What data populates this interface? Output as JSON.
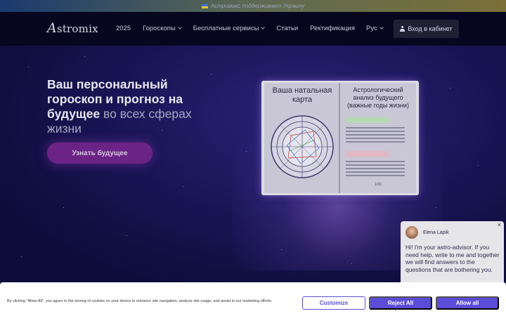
{
  "ribbon": {
    "text": "Астромикс поддерживает Украину"
  },
  "header": {
    "logo": {
      "initial": "A",
      "rest": "stromix"
    },
    "nav": [
      {
        "label": "2025",
        "has_dropdown": false
      },
      {
        "label": "Гороскопы",
        "has_dropdown": true
      },
      {
        "label": "Бесплатные сервисы",
        "has_dropdown": true
      },
      {
        "label": "Статьи",
        "has_dropdown": false
      },
      {
        "label": "Ректификация",
        "has_dropdown": false
      }
    ],
    "language": "Рус",
    "login_label": "Вход в кабинет"
  },
  "hero": {
    "title_bold": "Ваш персональный гороскоп и прогноз на будущее",
    "title_light": " во всех сферах жизни",
    "cta_label": "Узнать будущее"
  },
  "book": {
    "left_title": "Ваша натальная карта",
    "right_title": "Астрологический анализ будущего (важные годы жизни)",
    "page_number": "1/30"
  },
  "chat": {
    "name": "Elena Lapik",
    "message": "Hi! I'm your astro-advisor. If you need help, write to me and together we will find answers to the questions that are bothering you.",
    "close_glyph": "×"
  },
  "cookie": {
    "text": "By clicking \"Allow All\", you agree to the storing of cookies on your device to enhance site navigation, analyze site usage, and assist in our marketing efforts.",
    "customize_label": "Customize",
    "reject_label": "Reject All",
    "accept_label": "Allow all"
  },
  "colors": {
    "background": "#0d0b33",
    "cta": "#6b2486",
    "accent_button": "#5b4dd8"
  }
}
